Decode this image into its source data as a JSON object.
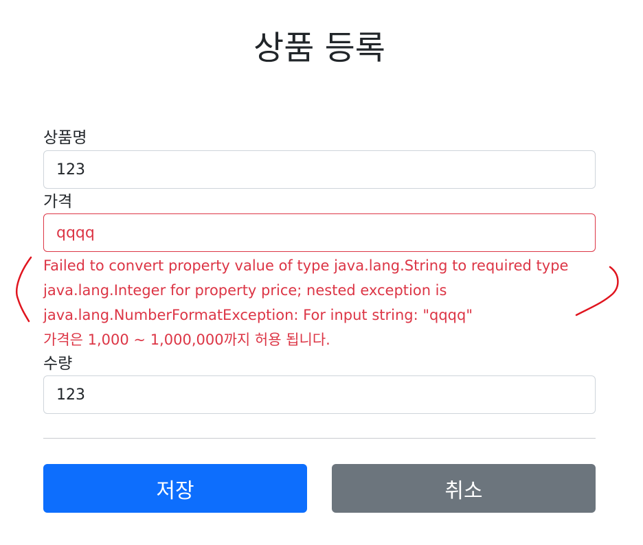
{
  "page": {
    "title": "상품 등록"
  },
  "form": {
    "name": {
      "label": "상품명",
      "value": "123"
    },
    "price": {
      "label": "가격",
      "value": "qqqq",
      "errors": [
        "Failed to convert property value of type java.lang.String to required type",
        "java.lang.Integer for property price; nested exception is",
        "java.lang.NumberFormatException: For input string: \"qqqq\"",
        "가격은 1,000 ~ 1,000,000까지 허용 됩니다."
      ]
    },
    "quantity": {
      "label": "수량",
      "value": "123"
    }
  },
  "buttons": {
    "save_label": "저장",
    "cancel_label": "취소"
  },
  "colors": {
    "primary": "#0d6efd",
    "secondary": "#6c757d",
    "error": "#dc3545",
    "annotation": "#e0141e"
  }
}
